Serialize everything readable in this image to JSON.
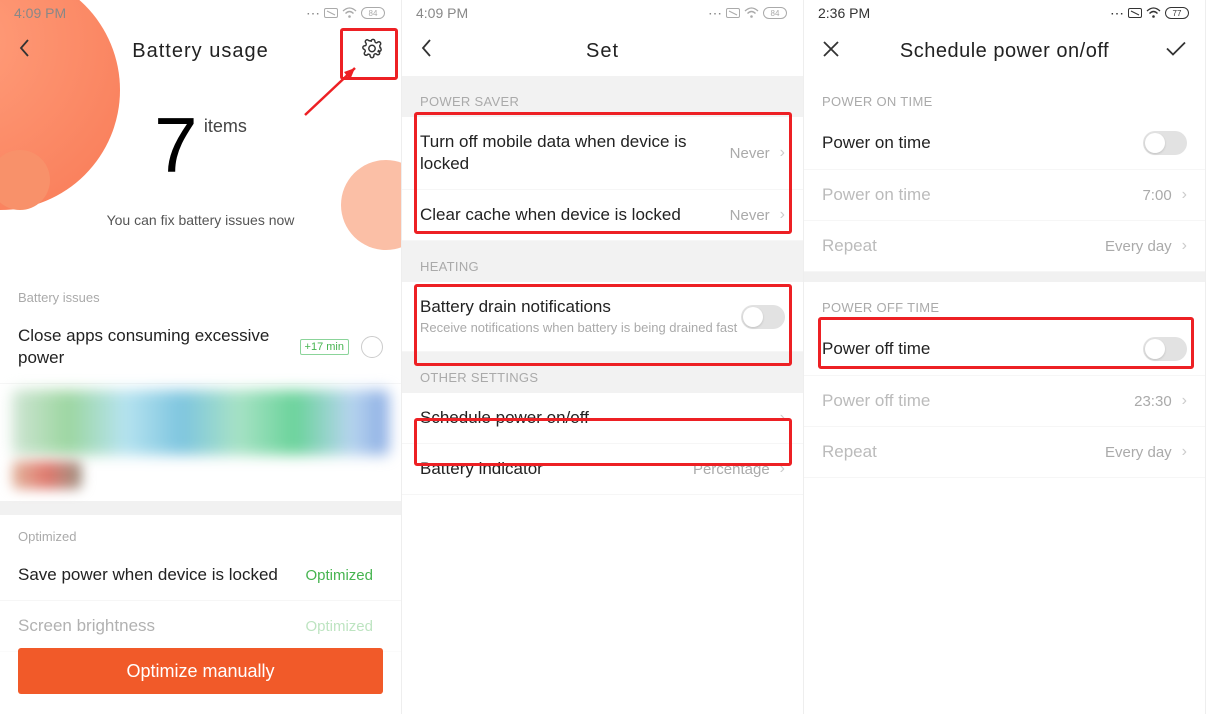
{
  "screen1": {
    "time": "4:09 PM",
    "battery_pct": "84",
    "title": "Battery usage",
    "hero_number": "7",
    "hero_items": "items",
    "hero_sub": "You can fix battery issues now",
    "issues_head": "Battery issues",
    "close_apps": "Close apps consuming excessive power",
    "close_apps_badge": "+17 min",
    "optimized_head": "Optimized",
    "save_power_row": "Save power when device is locked",
    "save_power_val": "Optimized",
    "brightness_row": "Screen brightness",
    "brightness_val": "Optimized",
    "optimize_btn": "Optimize manually"
  },
  "screen2": {
    "time": "4:09 PM",
    "battery_pct": "84",
    "title": "Set",
    "head_power_saver": "POWER SAVER",
    "row_mobile_data": "Turn off mobile data when device is locked",
    "row_mobile_data_val": "Never",
    "row_clear_cache": "Clear cache when device is locked",
    "row_clear_cache_val": "Never",
    "head_heating": "HEATING",
    "row_drain": "Battery drain notifications",
    "row_drain_sub": "Receive notifications when battery is being drained fast",
    "head_other": "OTHER SETTINGS",
    "row_schedule": "Schedule power on/off",
    "row_indicator": "Battery indicator",
    "row_indicator_val": "Percentage"
  },
  "screen3": {
    "time": "2:36 PM",
    "battery_pct": "77",
    "title": "Schedule power on/off",
    "head_on": "POWER ON TIME",
    "on_toggle_label": "Power on time",
    "on_time_label": "Power on time",
    "on_time_val": "7:00",
    "on_repeat_label": "Repeat",
    "on_repeat_val": "Every day",
    "head_off": "POWER OFF TIME",
    "off_toggle_label": "Power off time",
    "off_time_label": "Power off time",
    "off_time_val": "23:30",
    "off_repeat_label": "Repeat",
    "off_repeat_val": "Every day"
  }
}
